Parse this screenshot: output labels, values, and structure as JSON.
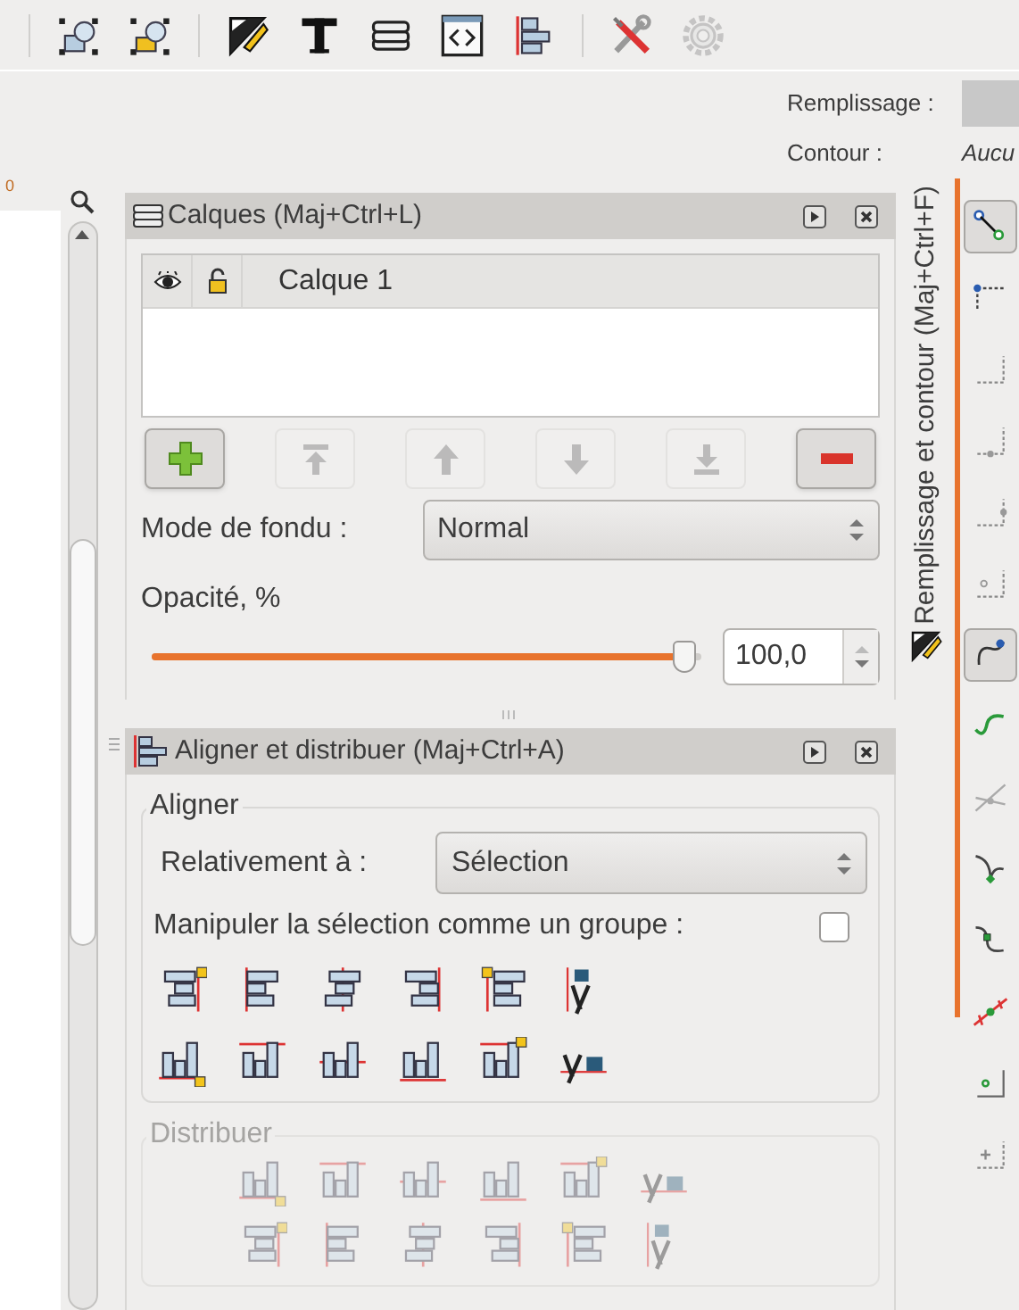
{
  "toolbar": {
    "items": [
      {
        "kind": "separator"
      },
      {
        "kind": "zoom-selection",
        "disabled": false
      },
      {
        "kind": "zoom-drawing",
        "disabled": false
      },
      {
        "kind": "separator"
      },
      {
        "kind": "fill-stroke",
        "disabled": false
      },
      {
        "kind": "text",
        "disabled": false
      },
      {
        "kind": "layers",
        "disabled": false
      },
      {
        "kind": "xml",
        "disabled": false
      },
      {
        "kind": "align",
        "disabled": false
      },
      {
        "kind": "separator"
      },
      {
        "kind": "preferences",
        "disabled": false
      },
      {
        "kind": "document-properties",
        "disabled": true
      }
    ]
  },
  "style_indicator": {
    "fill_label": "Remplissage :",
    "stroke_label": "Contour :",
    "stroke_value": "Aucu"
  },
  "ruler": {
    "label": "0"
  },
  "layers_panel": {
    "title": "Calques (Maj+Ctrl+L)",
    "layers": [
      {
        "name": "Calque 1"
      }
    ],
    "buttons": [
      {
        "kind": "add",
        "disabled": false
      },
      {
        "kind": "top",
        "disabled": true
      },
      {
        "kind": "up",
        "disabled": true
      },
      {
        "kind": "down",
        "disabled": true
      },
      {
        "kind": "bottom",
        "disabled": true
      },
      {
        "kind": "remove",
        "disabled": false
      }
    ],
    "blend_label": "Mode de fondu :",
    "blend_value": "Normal",
    "opacity_label": "Opacité, %",
    "opacity": {
      "level": 0.97,
      "value": "100,0"
    }
  },
  "align_panel": {
    "title": "Aligner et distribuer (Maj+Ctrl+A)",
    "align_group": {
      "legend": "Aligner",
      "relative_label": "Relativement à :",
      "relative_value": "Sélection",
      "group_label": "Manipuler la sélection comme un groupe :",
      "group_checked": false
    },
    "distribute_group": {
      "legend": "Distribuer",
      "disabled": true
    }
  },
  "side_tab": {
    "label": "Remplissage et contour (Maj+Ctrl+F)"
  },
  "snap_toolbar": [
    {
      "kind": "snap-toggle",
      "on": true
    },
    {
      "kind": "bbox-corner",
      "on": false
    },
    {
      "kind": "bbox-edge",
      "on": false
    },
    {
      "kind": "bbox-edge-mid",
      "on": false
    },
    {
      "kind": "bbox-center",
      "on": false
    },
    {
      "kind": "bbox-small",
      "on": false
    },
    {
      "kind": "path-node",
      "on": true
    },
    {
      "kind": "path",
      "on": false
    },
    {
      "kind": "intersection",
      "on": false
    },
    {
      "kind": "cusp",
      "on": false
    },
    {
      "kind": "smooth",
      "on": false
    },
    {
      "kind": "midpoint",
      "on": false
    },
    {
      "kind": "object-center",
      "on": false
    },
    {
      "kind": "rotation-center",
      "on": false
    }
  ]
}
